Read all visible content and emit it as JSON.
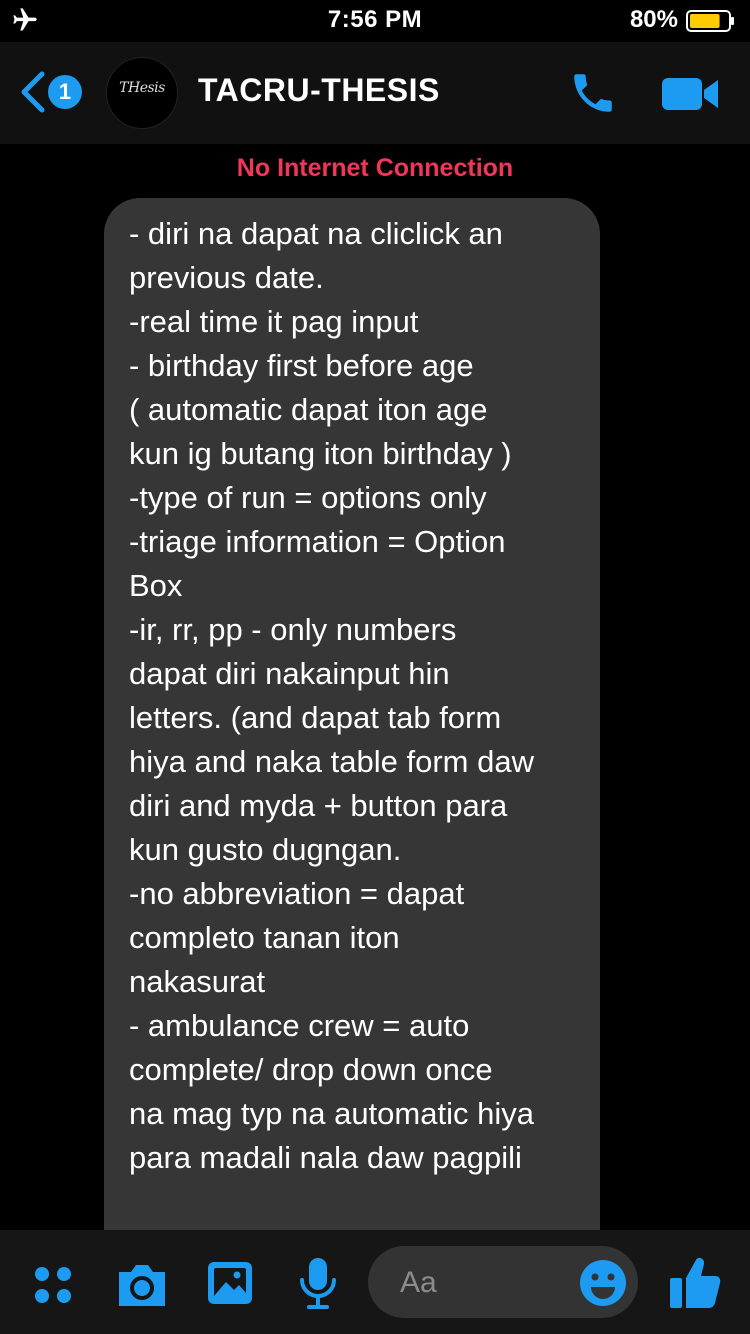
{
  "status_bar": {
    "time": "7:56 PM",
    "battery": "80%",
    "battery_level": 0.8
  },
  "header": {
    "unread_count": "1",
    "avatar_logo": "THesis",
    "title": "TACRU-THESIS",
    "icons": [
      "chevron-left-icon",
      "phone-icon",
      "video-camera-icon"
    ]
  },
  "alert": {
    "text": "No Internet Connection"
  },
  "message": {
    "lines": [
      "- diri na dapat na cliclick an",
      "previous date.",
      "-real time it pag input",
      "- birthday first before age",
      "( automatic dapat iton age",
      "kun ig butang iton birthday )",
      "-type of run = options only",
      "-triage information = Option",
      "Box",
      "-ir, rr, pp - only numbers",
      "dapat diri nakainput hin",
      "letters. (and dapat tab form",
      "hiya and naka table form daw",
      "diri and myda + button para",
      "kun gusto dugngan.",
      "-no abbreviation = dapat",
      "completo tanan iton",
      "nakasurat",
      "- ambulance crew = auto",
      "complete/ drop down once",
      "na mag typ na automatic hiya",
      "para madali nala daw pagpili"
    ]
  },
  "composer": {
    "placeholder": "Aa",
    "icons": [
      "apps-icon",
      "camera-icon",
      "gallery-icon",
      "microphone-icon",
      "emoji-icon",
      "thumbs-up-icon"
    ]
  },
  "colors": {
    "accent": "#1d9bf0",
    "alert": "#f0365b",
    "bubble": "#363636",
    "battery": "#ffcc00"
  }
}
